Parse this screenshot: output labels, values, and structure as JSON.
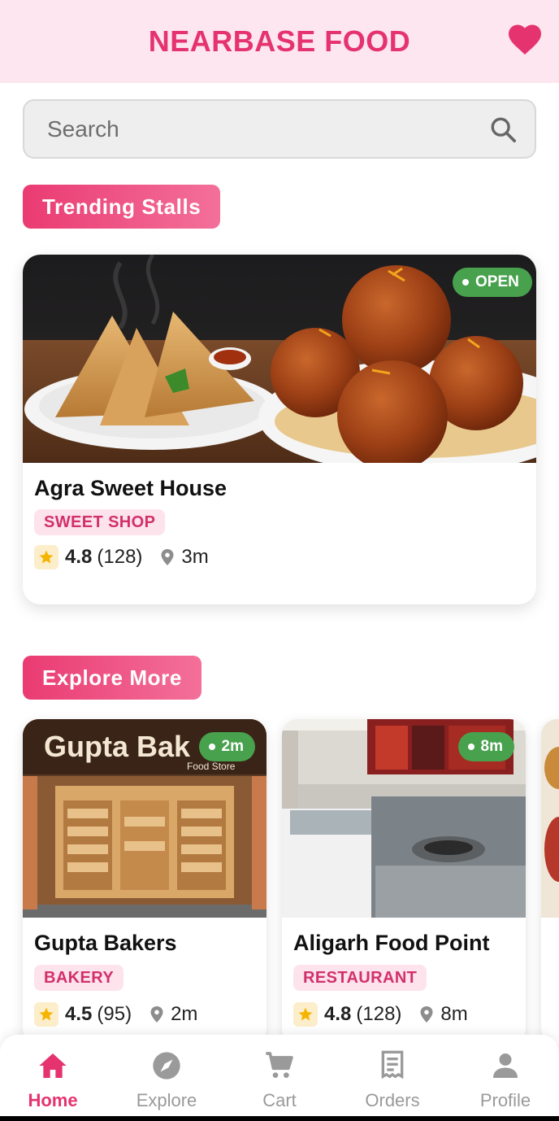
{
  "header": {
    "title": "NEARBASE FOOD",
    "favorite_icon": "heart-icon",
    "accent": "#e5336f",
    "background": "#fde6ef"
  },
  "search": {
    "placeholder": "Search",
    "icon": "search-icon"
  },
  "trending": {
    "section_label": "Trending Stalls",
    "stall": {
      "name": "Agra Sweet House",
      "status": "OPEN",
      "category": "SWEET SHOP",
      "rating": "4.8",
      "reviews": "(128)",
      "distance": "3m",
      "image": "samosa and gulab jamun plates"
    }
  },
  "explore": {
    "section_label": "Explore More",
    "stalls": [
      {
        "name": "Gupta Bakers",
        "sign_text": "Gupta Bak",
        "sign_subtext": "Food Store",
        "distance_badge": "2m",
        "category": "BAKERY",
        "rating": "4.5",
        "reviews": "(95)",
        "distance": "2m",
        "image": "bakery storefront"
      },
      {
        "name": "Aligarh Food Point",
        "distance_badge": "8m",
        "category": "RESTAURANT",
        "rating": "4.8",
        "reviews": "(128)",
        "distance": "8m",
        "image": "restaurant kitchen counter"
      }
    ]
  },
  "nav": {
    "items": [
      {
        "label": "Home",
        "icon": "home-icon",
        "active": true
      },
      {
        "label": "Explore",
        "icon": "compass-icon",
        "active": false
      },
      {
        "label": "Cart",
        "icon": "cart-icon",
        "active": false
      },
      {
        "label": "Orders",
        "icon": "receipt-icon",
        "active": false
      },
      {
        "label": "Profile",
        "icon": "person-icon",
        "active": false
      }
    ]
  },
  "colors": {
    "open_badge": "#48a14d",
    "tag_bg": "#fde3ec",
    "tag_text": "#d2306a",
    "star": "#f5b400"
  }
}
